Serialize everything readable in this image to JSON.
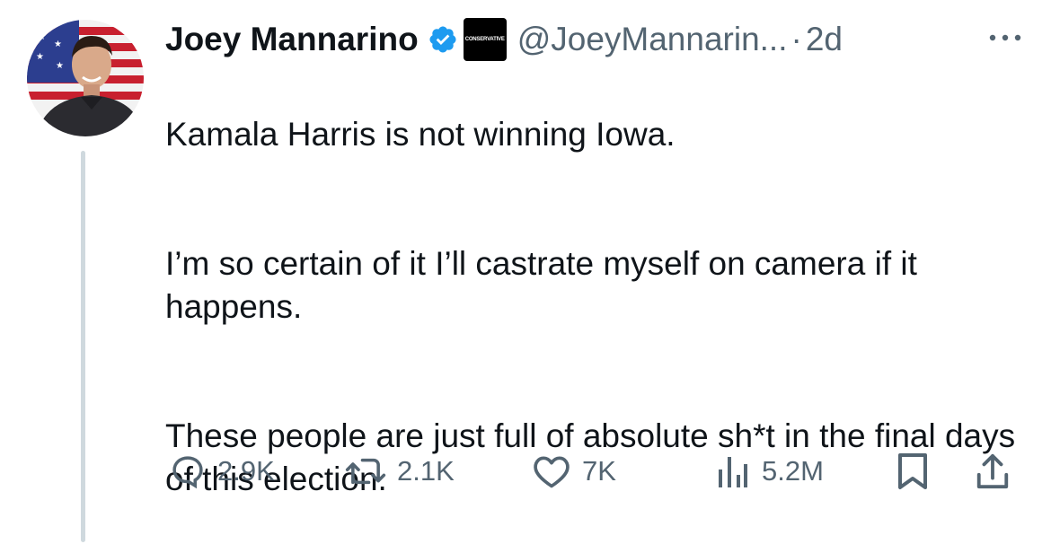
{
  "author": {
    "name": "Joey Mannarino",
    "handle": "@JoeyMannarin...",
    "separator": "·",
    "time": "2d",
    "affiliation_badge": "CONSERVATIVE",
    "verified_color": "#1d9bf0"
  },
  "tweet": {
    "paragraphs": [
      "Kamala Harris is not winning Iowa.",
      "I’m so certain of it I’ll castrate myself on camera if it happens.",
      "These people are just full of absolute sh*t in the final days of this election."
    ]
  },
  "actions": {
    "reply": {
      "icon": "reply-icon",
      "count": "2.9K"
    },
    "retweet": {
      "icon": "retweet-icon",
      "count": "2.1K"
    },
    "like": {
      "icon": "heart-icon",
      "count": "7K"
    },
    "views": {
      "icon": "views-chart-icon",
      "count": "5.2M"
    },
    "bookmark": {
      "icon": "bookmark-icon"
    },
    "share": {
      "icon": "share-icon"
    }
  },
  "colors": {
    "text": "#0f1419",
    "muted": "#536471",
    "thread_line": "#cfd9de"
  }
}
